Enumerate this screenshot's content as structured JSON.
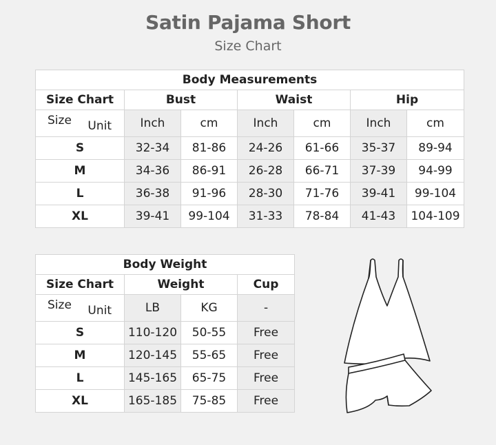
{
  "title": "Satin Pajama Short",
  "subtitle": "Size Chart",
  "body_measurements": {
    "caption": "Body Measurements",
    "size_chart_label": "Size Chart",
    "groups": [
      "Bust",
      "Waist",
      "Hip"
    ],
    "size_label": "Size",
    "unit_label": "Unit",
    "units": [
      "Inch",
      "cm",
      "Inch",
      "cm",
      "Inch",
      "cm"
    ],
    "rows": [
      {
        "size": "S",
        "values": [
          "32-34",
          "81-86",
          "24-26",
          "61-66",
          "35-37",
          "89-94"
        ]
      },
      {
        "size": "M",
        "values": [
          "34-36",
          "86-91",
          "26-28",
          "66-71",
          "37-39",
          "94-99"
        ]
      },
      {
        "size": "L",
        "values": [
          "36-38",
          "91-96",
          "28-30",
          "71-76",
          "39-41",
          "99-104"
        ]
      },
      {
        "size": "XL",
        "values": [
          "39-41",
          "99-104",
          "31-33",
          "78-84",
          "41-43",
          "104-109"
        ]
      }
    ]
  },
  "body_weight": {
    "caption": "Body Weight",
    "size_chart_label": "Size Chart",
    "weight_label": "Weight",
    "cup_label": "Cup",
    "size_label": "Size",
    "unit_label": "Unit",
    "units": [
      "LB",
      "KG",
      "-"
    ],
    "rows": [
      {
        "size": "S",
        "values": [
          "110-120",
          "50-55",
          "Free"
        ]
      },
      {
        "size": "M",
        "values": [
          "120-145",
          "55-65",
          "Free"
        ]
      },
      {
        "size": "L",
        "values": [
          "145-165",
          "65-75",
          "Free"
        ]
      },
      {
        "size": "XL",
        "values": [
          "165-185",
          "75-85",
          "Free"
        ]
      }
    ]
  },
  "illustration": "camisole-and-shorts-set-icon"
}
